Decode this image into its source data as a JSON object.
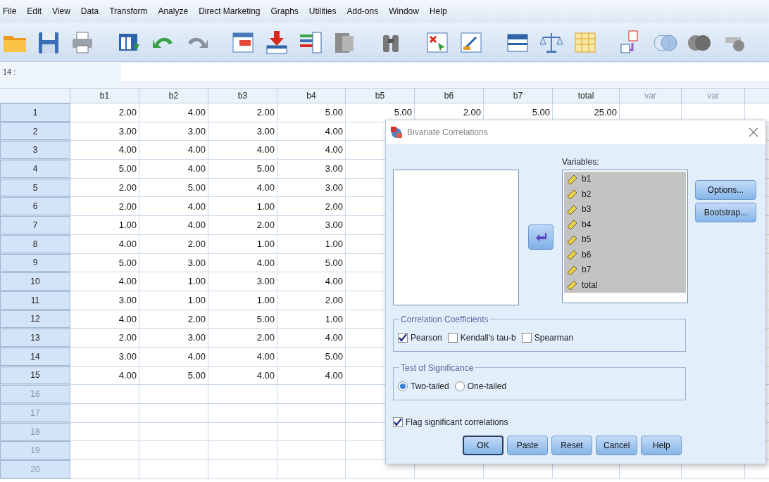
{
  "menu": [
    "File",
    "Edit",
    "View",
    "Data",
    "Transform",
    "Analyze",
    "Direct Marketing",
    "Graphs",
    "Utilities",
    "Add-ons",
    "Window",
    "Help"
  ],
  "cell_reference": "14 :",
  "grid": {
    "columns": [
      {
        "label": "b1",
        "kind": "var"
      },
      {
        "label": "b2",
        "kind": "var"
      },
      {
        "label": "b3",
        "kind": "var"
      },
      {
        "label": "b4",
        "kind": "var"
      },
      {
        "label": "b5",
        "kind": "var"
      },
      {
        "label": "b6",
        "kind": "var"
      },
      {
        "label": "b7",
        "kind": "var"
      },
      {
        "label": "total",
        "kind": "var"
      },
      {
        "label": "var",
        "kind": "empty"
      },
      {
        "label": "var",
        "kind": "empty"
      }
    ],
    "rows": [
      {
        "label": "1",
        "cells": [
          "2.00",
          "4.00",
          "2.00",
          "5.00",
          "5.00",
          "2.00",
          "5.00",
          "25.00"
        ]
      },
      {
        "label": "2",
        "cells": [
          "3.00",
          "3.00",
          "3.00",
          "4.00"
        ]
      },
      {
        "label": "3",
        "cells": [
          "4.00",
          "4.00",
          "4.00",
          "4.00"
        ]
      },
      {
        "label": "4",
        "cells": [
          "5.00",
          "4.00",
          "5.00",
          "3.00"
        ]
      },
      {
        "label": "5",
        "cells": [
          "2.00",
          "5.00",
          "4.00",
          "3.00"
        ]
      },
      {
        "label": "6",
        "cells": [
          "2.00",
          "4.00",
          "1.00",
          "2.00"
        ]
      },
      {
        "label": "7",
        "cells": [
          "1.00",
          "4.00",
          "2.00",
          "3.00"
        ]
      },
      {
        "label": "8",
        "cells": [
          "4.00",
          "2.00",
          "1.00",
          "1.00"
        ]
      },
      {
        "label": "9",
        "cells": [
          "5.00",
          "3.00",
          "4.00",
          "5.00"
        ]
      },
      {
        "label": "10",
        "cells": [
          "4.00",
          "1.00",
          "3.00",
          "4.00"
        ]
      },
      {
        "label": "11",
        "cells": [
          "3.00",
          "1.00",
          "1.00",
          "2.00"
        ]
      },
      {
        "label": "12",
        "cells": [
          "4.00",
          "2.00",
          "5.00",
          "1.00"
        ]
      },
      {
        "label": "13",
        "cells": [
          "2.00",
          "3.00",
          "2.00",
          "4.00"
        ]
      },
      {
        "label": "14",
        "cells": [
          "3.00",
          "4.00",
          "4.00",
          "5.00"
        ]
      },
      {
        "label": "15",
        "cells": [
          "4.00",
          "5.00",
          "4.00",
          "4.00"
        ]
      },
      {
        "label": "16",
        "cells": []
      },
      {
        "label": "17",
        "cells": []
      },
      {
        "label": "18",
        "cells": []
      },
      {
        "label": "19",
        "cells": []
      },
      {
        "label": "20",
        "cells": []
      }
    ]
  },
  "dialog": {
    "title": "Bivariate Correlations",
    "variables_label": {
      "text": "Variables:"
    },
    "variables": [
      {
        "name": "b1",
        "selected": true
      },
      {
        "name": "b2",
        "selected": true
      },
      {
        "name": "b3",
        "selected": true
      },
      {
        "name": "b4",
        "selected": true
      },
      {
        "name": "b5",
        "selected": true
      },
      {
        "name": "b6",
        "selected": true
      },
      {
        "name": "b7",
        "selected": true
      },
      {
        "name": "total",
        "selected": true
      }
    ],
    "side_buttons": [
      {
        "label": "Options..."
      },
      {
        "label": "Bootstrap..."
      }
    ],
    "coefficients": {
      "title": "Correlation Coefficients",
      "options": [
        {
          "label": "Pearson",
          "checked": true
        },
        {
          "label": "Kendall's tau-b",
          "checked": false
        },
        {
          "label": "Spearman",
          "checked": false
        }
      ]
    },
    "significance": {
      "title": "Test of Significance",
      "options": [
        {
          "label": "Two-tailed",
          "selected": true
        },
        {
          "label": "One-tailed",
          "selected": false
        }
      ]
    },
    "flag": {
      "label": "Flag significant correlations",
      "checked": true
    },
    "buttons": [
      {
        "label": "OK",
        "default": true
      },
      {
        "label": "Paste",
        "default": false
      },
      {
        "label": "Reset",
        "default": false
      },
      {
        "label": "Cancel",
        "default": false
      },
      {
        "label": "Help",
        "default": false
      }
    ]
  }
}
